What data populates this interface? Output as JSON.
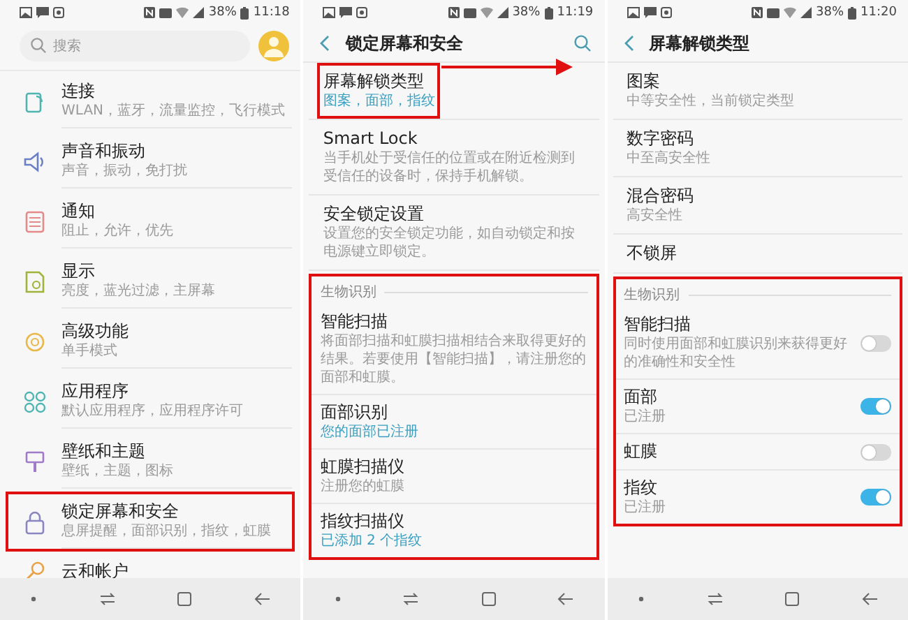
{
  "screens": [
    {
      "kind": "menu",
      "status_bar": {
        "battery": "38%",
        "time": "11:18"
      },
      "search": {
        "placeholder": "搜索"
      },
      "items": [
        {
          "title": "连接",
          "subtitle": "WLAN，蓝牙，流量监控，飞行模式",
          "highlighted": false
        },
        {
          "title": "声音和振动",
          "subtitle": "声音，振动，免打扰",
          "highlighted": false
        },
        {
          "title": "通知",
          "subtitle": "阻止，允许，优先",
          "highlighted": false
        },
        {
          "title": "显示",
          "subtitle": "亮度，蓝光过滤，主屏幕",
          "highlighted": false
        },
        {
          "title": "高级功能",
          "subtitle": "单手模式",
          "highlighted": false
        },
        {
          "title": "应用程序",
          "subtitle": "默认应用程序，应用程序许可",
          "highlighted": false
        },
        {
          "title": "壁纸和主题",
          "subtitle": "壁纸，主题，图标",
          "highlighted": false
        },
        {
          "title": "锁定屏幕和安全",
          "subtitle": "息屏提醒，面部识别，指纹，虹膜",
          "highlighted": true
        },
        {
          "title": "云和帐户",
          "highlighted": false
        }
      ]
    },
    {
      "kind": "detail",
      "status_bar": {
        "battery": "38%",
        "time": "11:19"
      },
      "title": "锁定屏幕和安全",
      "search_button": true,
      "items": [
        {
          "title": "屏幕解锁类型",
          "subtitle": "图案，面部，指纹",
          "accent": true,
          "highlighted": true
        },
        {
          "title": "Smart Lock",
          "subtitle": "当手机处于受信任的位置或在附近检测到受信任的设备时，保持手机解锁。",
          "accent": false,
          "highlighted": false
        },
        {
          "title": "安全锁定设置",
          "subtitle": "设置您的安全锁定功能，如自动锁定和按电源键立即锁定。",
          "accent": false,
          "highlighted": false
        }
      ],
      "section": {
        "title": "生物识别",
        "highlighted": true,
        "items": [
          {
            "kind": "link",
            "title": "智能扫描",
            "subtitle": "将面部扫描和虹膜扫描相结合来取得更好的结果。若要使用【智能扫描】，请注册您的面部和虹膜。",
            "accent": false
          },
          {
            "kind": "link",
            "title": "面部识别",
            "subtitle": "您的面部已注册",
            "accent": true
          },
          {
            "kind": "link",
            "title": "虹膜扫描仪",
            "subtitle": "注册您的虹膜",
            "accent": false
          },
          {
            "kind": "link",
            "title": "指纹扫描仪",
            "subtitle": "已添加 2 个指纹",
            "accent": true
          }
        ]
      }
    },
    {
      "kind": "detail",
      "status_bar": {
        "battery": "38%",
        "time": "11:20"
      },
      "title": "屏幕解锁类型",
      "search_button": false,
      "items": [
        {
          "title": "图案",
          "subtitle": "中等安全性，当前锁定类型",
          "accent": false,
          "highlighted": false
        },
        {
          "title": "数字密码",
          "subtitle": "中至高安全性",
          "accent": false,
          "highlighted": false
        },
        {
          "title": "混合密码",
          "subtitle": "高安全性",
          "accent": false,
          "highlighted": false
        },
        {
          "title": "不锁屏",
          "highlighted": false
        }
      ],
      "section": {
        "title": "生物识别",
        "highlighted": true,
        "items": [
          {
            "kind": "toggle",
            "title": "智能扫描",
            "subtitle": "同时使用面部和虹膜识别来获得更好的准确性和安全性",
            "on": false
          },
          {
            "kind": "toggle",
            "title": "面部",
            "subtitle": "已注册",
            "on": true
          },
          {
            "kind": "toggle",
            "title": "虹膜",
            "on": false
          },
          {
            "kind": "toggle",
            "title": "指纹",
            "subtitle": "已注册",
            "on": true
          }
        ]
      }
    }
  ],
  "annotation_arrow": true
}
